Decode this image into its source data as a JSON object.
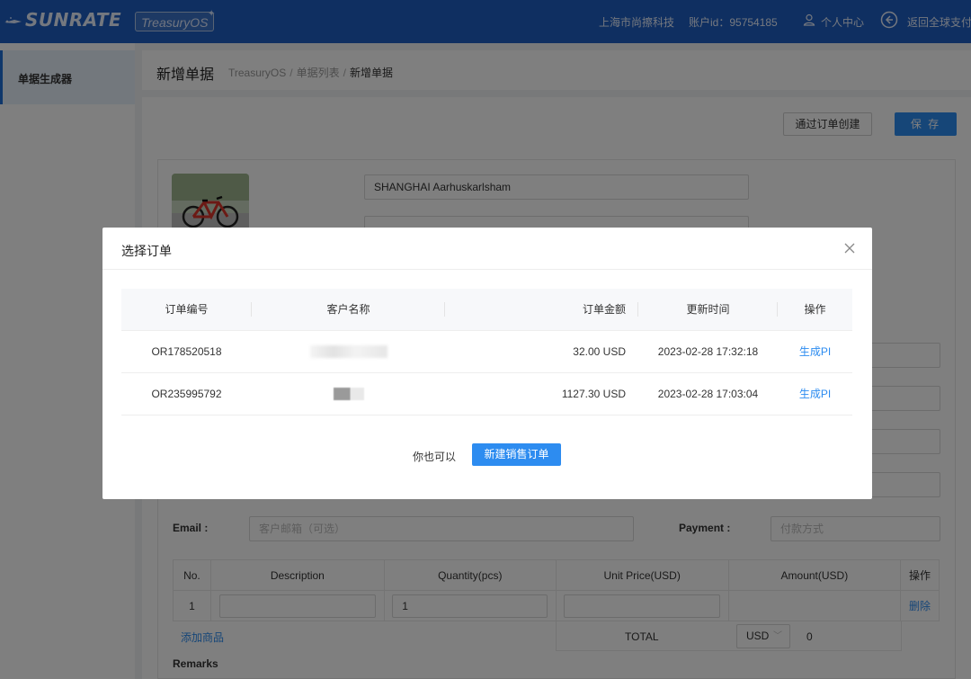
{
  "header": {
    "logo": "SUNRATE",
    "product_badge": "TreasuryOS",
    "company": "上海市尚擦科技",
    "account": "账户id：95754185",
    "personal_center": "个人中心",
    "back_label": "返回全球支付",
    "icons": {
      "logo": "logo-mark-icon",
      "user": "user-icon",
      "back": "back-arrow-icon"
    },
    "colors": {
      "bar": "#1f5fc2"
    }
  },
  "sidebar": {
    "items": [
      {
        "label": "单据生成器",
        "active": true
      }
    ]
  },
  "page": {
    "title": "新增单据",
    "breadcrumb": [
      "TreasuryOS",
      "单据列表",
      "新增单据"
    ]
  },
  "toolbar": {
    "create_from_order": "通过订单创建",
    "save": "保 存",
    "accent": "#2d8cf0"
  },
  "form": {
    "company_name_value": "SHANGHAI Aarhuskarlsham",
    "email_label": "Email :",
    "email_placeholder": "客户邮箱（可选）",
    "payment_label": "Payment :",
    "payment_placeholder": "付款方式"
  },
  "items": {
    "headers": [
      "No.",
      "Description",
      "Quantity(pcs)",
      "Unit Price(USD)",
      "Amount(USD)",
      "操作"
    ],
    "rows": [
      {
        "no": "1",
        "description": "",
        "quantity": "1",
        "unit_price": "",
        "amount": "",
        "action": "删除"
      }
    ],
    "add_label": "添加商品",
    "total_label": "TOTAL",
    "currency": "USD",
    "total_value": "0",
    "remarks_label": "Remarks"
  },
  "modal": {
    "title": "选择订单",
    "columns": [
      "订单编号",
      "客户名称",
      "订单金额",
      "更新时间",
      "操作"
    ],
    "rows": [
      {
        "order_no": "OR178520518",
        "amount": "32.00 USD",
        "updated": "2023-02-28 17:32:18",
        "action": "生成PI"
      },
      {
        "order_no": "OR235995792",
        "amount": "1127.30 USD",
        "updated": "2023-02-28 17:03:04",
        "action": "生成PI"
      }
    ],
    "alt_text": "你也可以",
    "new_order_button": "新建销售订单"
  }
}
